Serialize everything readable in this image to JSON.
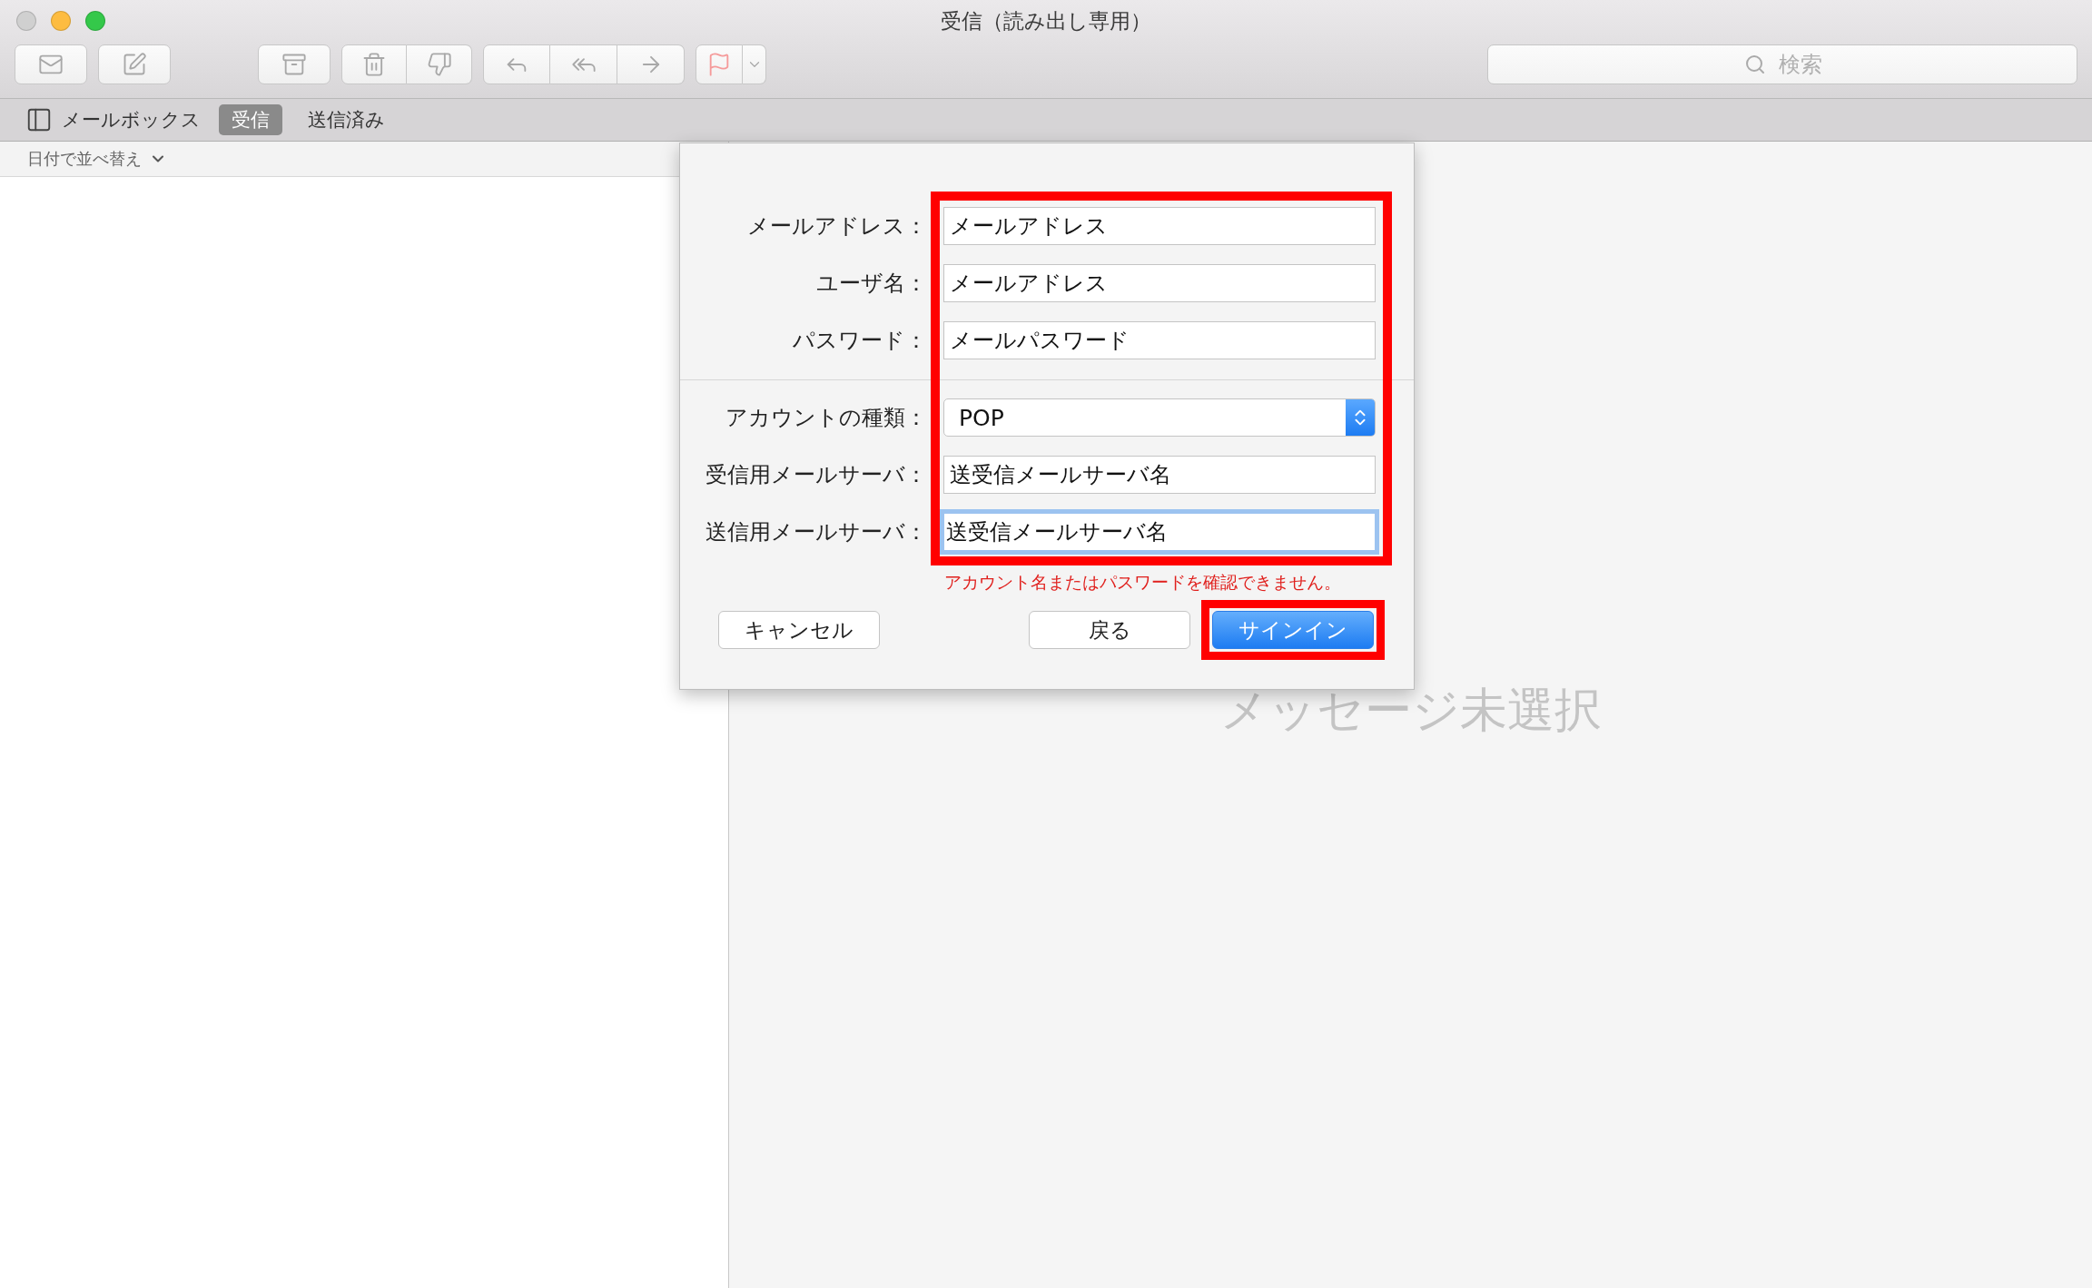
{
  "window": {
    "title": "受信（読み出し専用）"
  },
  "toolbar": {
    "search": {
      "placeholder": "検索"
    }
  },
  "tab_bar": {
    "mailboxes_label": "メールボックス",
    "tabs": [
      {
        "label": "受信",
        "selected": true
      },
      {
        "label": "送信済み",
        "selected": false
      }
    ]
  },
  "message_list": {
    "sort_label": "日付で並べ替え"
  },
  "detail": {
    "empty_message": "メッセージ未選択"
  },
  "dialog": {
    "highlight_fields": true,
    "sections": [
      {
        "fields": [
          {
            "label": "メールアドレス：",
            "kind": "text",
            "value": "メールアドレス",
            "focused": false
          },
          {
            "label": "ユーザ名：",
            "kind": "text",
            "value": "メールアドレス",
            "focused": false
          },
          {
            "label": "パスワード：",
            "kind": "text",
            "value": "メールパスワード",
            "focused": false
          }
        ]
      },
      {
        "fields": [
          {
            "label": "アカウントの種類：",
            "kind": "popup",
            "value": "POP",
            "focused": false
          },
          {
            "label": "受信用メールサーバ：",
            "kind": "text",
            "value": "送受信メールサーバ名",
            "focused": false
          },
          {
            "label": "送信用メールサーバ：",
            "kind": "text",
            "value": "送受信メールサーバ名",
            "focused": true
          }
        ]
      }
    ],
    "error": "アカウント名またはパスワードを確認できません。",
    "buttons": [
      {
        "label": "キャンセル",
        "kind": "cancel",
        "highlighted": false
      },
      {
        "label": "戻る",
        "kind": "back",
        "highlighted": false
      },
      {
        "label": "サインイン",
        "kind": "primary",
        "highlighted": true
      }
    ]
  }
}
